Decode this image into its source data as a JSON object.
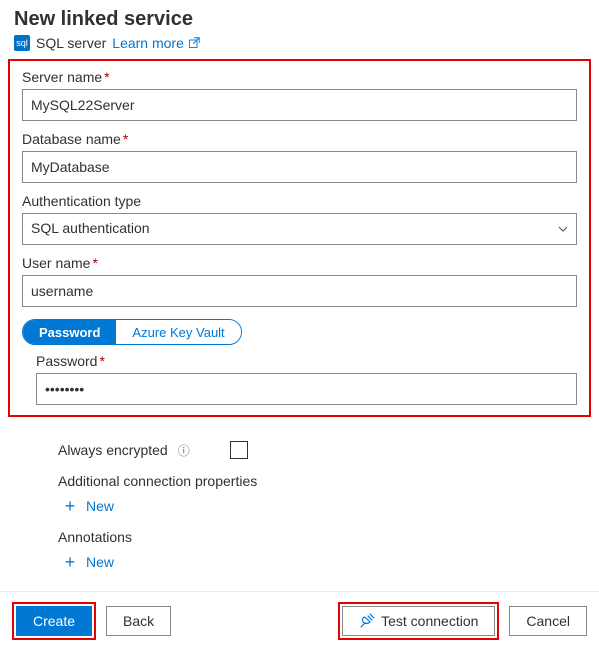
{
  "header": {
    "title": "New linked service",
    "service_name": "SQL server",
    "learn_more": "Learn more"
  },
  "form": {
    "server_name": {
      "label": "Server name",
      "required": "*",
      "value": "MySQL22Server"
    },
    "database_name": {
      "label": "Database name",
      "required": "*",
      "value": "MyDatabase"
    },
    "auth_type": {
      "label": "Authentication type",
      "value": "SQL authentication"
    },
    "user_name": {
      "label": "User name",
      "required": "*",
      "value": "username"
    },
    "cred_tabs": {
      "password": "Password",
      "akv": "Azure Key Vault"
    },
    "password": {
      "label": "Password",
      "required": "*",
      "value": "••••••••"
    }
  },
  "extras": {
    "always_encrypted": "Always encrypted",
    "additional_props": "Additional connection properties",
    "annotations": "Annotations",
    "new": "New"
  },
  "footer": {
    "create": "Create",
    "back": "Back",
    "test": "Test connection",
    "cancel": "Cancel"
  }
}
